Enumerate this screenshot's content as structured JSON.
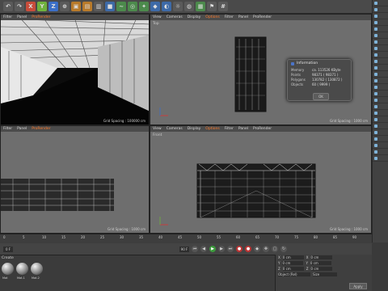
{
  "toolbar": {
    "axis_labels": [
      "X",
      "Y",
      "Z"
    ],
    "icons": [
      "undo-icon",
      "redo-icon",
      "select-icon",
      "move-icon",
      "scale-icon",
      "rotate-icon",
      "object-icon",
      "spline-icon",
      "nurbs-icon",
      "array-icon",
      "deformer-icon",
      "render-view-icon",
      "render-icon",
      "edit-render-icon",
      "light-icon",
      "floor-icon",
      "camera-icon",
      "tag-icon",
      "snap-icon",
      "workplane-icon"
    ]
  },
  "viewports": {
    "menu_items": [
      "View",
      "Cameras",
      "Display",
      "Options",
      "Filter",
      "Panel",
      "ProRender"
    ],
    "perspective": {
      "label": "",
      "grid_spacing": "Grid Spacing : 100000 cm"
    },
    "top": {
      "label": "Top",
      "grid_spacing": "Grid Spacing : 1000 cm"
    },
    "right": {
      "label": "",
      "grid_spacing": "Grid Spacing : 1000 cm"
    },
    "front": {
      "label": "Front",
      "grid_spacing": "Grid Spacing : 1000 cm"
    }
  },
  "info_dialog": {
    "title": "Information",
    "rows": [
      {
        "label": "Memory",
        "value": "ca. 113526 KByte"
      },
      {
        "label": "Points",
        "value": "98371 ( 98371 )"
      },
      {
        "label": "Polygons",
        "value": "130782 ( 130872 )"
      },
      {
        "label": "Objects",
        "value": "60 ( 9999 )"
      }
    ],
    "ok_label": "OK"
  },
  "timeline": {
    "ticks": [
      "0",
      "5",
      "10",
      "15",
      "20",
      "25",
      "30",
      "35",
      "40",
      "45",
      "50",
      "55",
      "60",
      "65",
      "70",
      "75",
      "80",
      "85",
      "90"
    ],
    "frame_field": "0 F",
    "end_field": "90 F"
  },
  "materials": {
    "tab_label": "Create",
    "items": [
      "Mat",
      "Mat.1",
      "Mat.2"
    ]
  },
  "coords": {
    "rows": [
      {
        "axis": "X",
        "value": "0 cm",
        "axis2": "X",
        "value2": "0 cm"
      },
      {
        "axis": "Y",
        "value": "0 cm",
        "axis2": "Y",
        "value2": "0 cm"
      },
      {
        "axis": "Z",
        "value": "0 cm",
        "axis2": "Z",
        "value2": "0 cm"
      }
    ],
    "mode_object": "Object (Rel)",
    "mode_size": "Size",
    "apply_label": "Apply"
  },
  "colors": {
    "accent": "#ff7a2a",
    "viewport_bg": "#6e6e6e",
    "perspective_bg": "#101010"
  }
}
